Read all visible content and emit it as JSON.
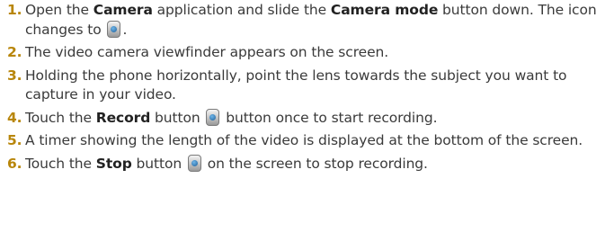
{
  "steps": [
    {
      "num": "1.",
      "parts": {
        "t1": "Open the ",
        "b1": "Camera",
        "t2": " application and slide the ",
        "b2": "Camera mode",
        "t3": " button down. The icon changes to ",
        "t4": "."
      },
      "icon": "video-mode-icon"
    },
    {
      "num": "2.",
      "text": "The video camera viewfinder appears on the screen."
    },
    {
      "num": "3.",
      "text": "Holding the phone horizontally, point the lens towards the subject you want to capture in your video."
    },
    {
      "num": "4.",
      "parts": {
        "t1": "Touch the ",
        "b1": "Record",
        "t2": " button ",
        "t3": " button once to start recording."
      },
      "icon": "record-icon"
    },
    {
      "num": "5.",
      "text": "A timer showing the length of the video is displayed at the bottom of the screen."
    },
    {
      "num": "6.",
      "parts": {
        "t1": "Touch the ",
        "b1": "Stop",
        "t2": " button ",
        "t3": " on the screen to stop recording."
      },
      "icon": "stop-icon"
    }
  ]
}
